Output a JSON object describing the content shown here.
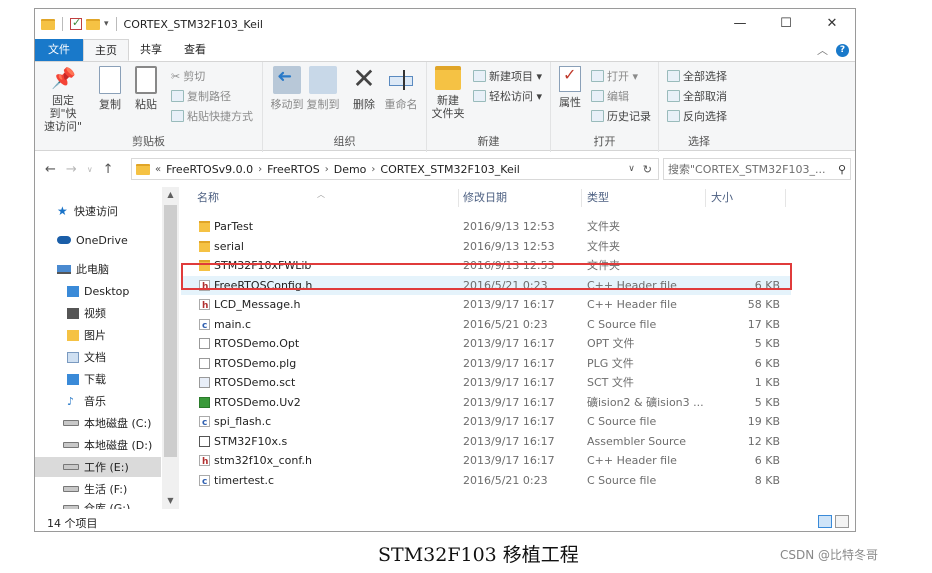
{
  "window": {
    "title": "CORTEX_STM32F103_Keil",
    "controls": {
      "minimize": "—",
      "maximize": "☐",
      "close": "✕"
    }
  },
  "ribbon_tabs": [
    "文件",
    "主页",
    "共享",
    "查看"
  ],
  "ribbon": {
    "clipboard": {
      "label": "剪贴板",
      "pin": "固定到\"快\n速访问\"",
      "copy": "复制",
      "paste": "粘贴",
      "cut": "剪切",
      "copy_path": "复制路径",
      "paste_shortcut": "粘贴快捷方式"
    },
    "organize": {
      "label": "组织",
      "move_to": "移动到",
      "copy_to": "复制到",
      "delete": "删除",
      "rename": "重命名"
    },
    "new": {
      "label": "新建",
      "new_folder": "新建\n文件夹",
      "new_item": "新建项目 ▾",
      "easy_access": "轻松访问 ▾"
    },
    "open": {
      "label": "打开",
      "properties": "属性",
      "open": "打开 ▾",
      "edit": "编辑",
      "history": "历史记录"
    },
    "select": {
      "label": "选择",
      "select_all": "全部选择",
      "select_none": "全部取消",
      "invert": "反向选择"
    }
  },
  "address": {
    "overflow": "«",
    "crumbs": [
      "FreeRTOSv9.0.0",
      "FreeRTOS",
      "Demo",
      "CORTEX_STM32F103_Keil"
    ],
    "search_placeholder": "搜索\"CORTEX_STM32F103_..."
  },
  "nav_pane": [
    {
      "label": "快速访问",
      "icon": "star-icon"
    },
    {
      "label": "OneDrive",
      "icon": "cloud-icon"
    },
    {
      "label": "此电脑",
      "icon": "computer-icon"
    },
    {
      "label": "Desktop",
      "icon": "folder-icon"
    },
    {
      "label": "视频",
      "icon": "video-icon"
    },
    {
      "label": "图片",
      "icon": "picture-icon"
    },
    {
      "label": "文档",
      "icon": "document-icon"
    },
    {
      "label": "下载",
      "icon": "download-icon"
    },
    {
      "label": "音乐",
      "icon": "music-icon"
    },
    {
      "label": "本地磁盘 (C:)",
      "icon": "drive-icon"
    },
    {
      "label": "本地磁盘 (D:)",
      "icon": "drive-icon"
    },
    {
      "label": "工作 (E:)",
      "icon": "drive-icon",
      "selected": true
    },
    {
      "label": "生活 (F:)",
      "icon": "drive-icon"
    },
    {
      "label": "仓库 (G:)",
      "icon": "drive-icon"
    }
  ],
  "columns": {
    "name": "名称",
    "date": "修改日期",
    "type": "类型",
    "size": "大小"
  },
  "files": [
    {
      "name": "ParTest",
      "date": "2016/9/13 12:53",
      "type": "文件夹",
      "size": "",
      "icon": "folder"
    },
    {
      "name": "serial",
      "date": "2016/9/13 12:53",
      "type": "文件夹",
      "size": "",
      "icon": "folder"
    },
    {
      "name": "STM32F10xFWLib",
      "date": "2016/9/13 12:53",
      "type": "文件夹",
      "size": "",
      "icon": "folder"
    },
    {
      "name": "FreeRTOSConfig.h",
      "date": "2016/5/21 0:23",
      "type": "C++ Header file",
      "size": "6 KB",
      "icon": "h",
      "highlighted": true
    },
    {
      "name": "LCD_Message.h",
      "date": "2013/9/17 16:17",
      "type": "C++ Header file",
      "size": "58 KB",
      "icon": "h"
    },
    {
      "name": "main.c",
      "date": "2016/5/21 0:23",
      "type": "C Source file",
      "size": "17 KB",
      "icon": "c"
    },
    {
      "name": "RTOSDemo.Opt",
      "date": "2013/9/17 16:17",
      "type": "OPT 文件",
      "size": "5 KB",
      "icon": "doc"
    },
    {
      "name": "RTOSDemo.plg",
      "date": "2013/9/17 16:17",
      "type": "PLG 文件",
      "size": "6 KB",
      "icon": "doc"
    },
    {
      "name": "RTOSDemo.sct",
      "date": "2013/9/17 16:17",
      "type": "SCT 文件",
      "size": "1 KB",
      "icon": "sct"
    },
    {
      "name": "RTOSDemo.Uv2",
      "date": "2013/9/17 16:17",
      "type": "礦ision2 & 礦ision3 ...",
      "size": "5 KB",
      "icon": "uv"
    },
    {
      "name": "spi_flash.c",
      "date": "2013/9/17 16:17",
      "type": "C Source file",
      "size": "19 KB",
      "icon": "c"
    },
    {
      "name": "STM32F10x.s",
      "date": "2013/9/17 16:17",
      "type": "Assembler Source",
      "size": "12 KB",
      "icon": "s"
    },
    {
      "name": "stm32f10x_conf.h",
      "date": "2013/9/17 16:17",
      "type": "C++ Header file",
      "size": "6 KB",
      "icon": "h"
    },
    {
      "name": "timertest.c",
      "date": "2016/5/21 0:23",
      "type": "C Source file",
      "size": "8 KB",
      "icon": "c"
    }
  ],
  "status": {
    "count": "14 个项目"
  },
  "caption": "STM32F103 移植工程",
  "watermark": "CSDN @比特冬哥"
}
